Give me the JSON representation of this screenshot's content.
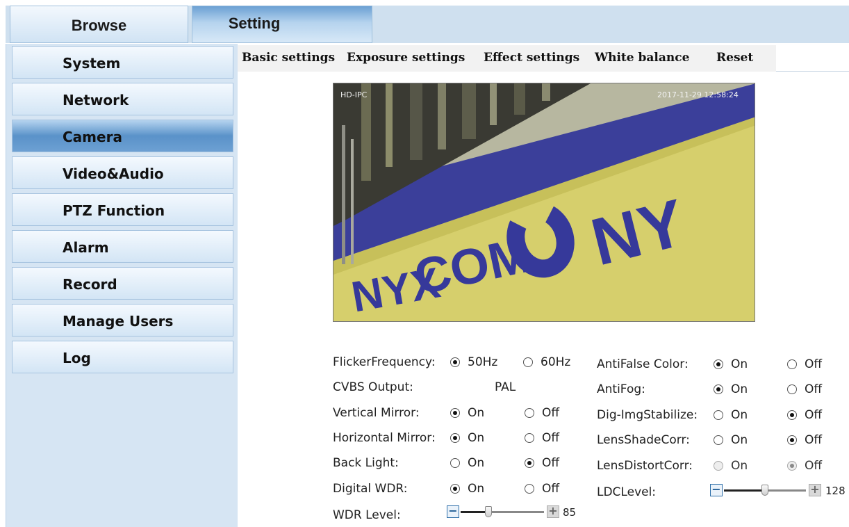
{
  "top_tabs": {
    "browse": "Browse",
    "setting": "Setting"
  },
  "sidebar": {
    "items": [
      {
        "label": "System"
      },
      {
        "label": "Network"
      },
      {
        "label": "Camera",
        "active": true
      },
      {
        "label": "Video&Audio"
      },
      {
        "label": "PTZ Function"
      },
      {
        "label": "Alarm"
      },
      {
        "label": "Record"
      },
      {
        "label": "Manage Users"
      },
      {
        "label": "Log"
      }
    ]
  },
  "sub_tabs": [
    "Basic settings",
    "Exposure settings",
    "Effect settings",
    "White balance",
    "Reset"
  ],
  "video": {
    "osd_name": "HD-IPC",
    "osd_time": "2017-11-29  12:58:24",
    "sign_left": "NYX",
    "sign_word": "COM",
    "sign_right": "NY"
  },
  "settings_left": {
    "flicker": {
      "label": "FlickerFrequency:",
      "opt1": "50Hz",
      "opt2": "60Hz",
      "selected": "50Hz"
    },
    "cvbs": {
      "label": "CVBS Output:",
      "value": "PAL"
    },
    "vmirror": {
      "label": "Vertical Mirror:",
      "opt1": "On",
      "opt2": "Off",
      "selected": "On"
    },
    "hmirror": {
      "label": "Horizontal Mirror:",
      "opt1": "On",
      "opt2": "Off",
      "selected": "On"
    },
    "backlight": {
      "label": "Back Light:",
      "opt1": "On",
      "opt2": "Off",
      "selected": "Off"
    },
    "dwdr": {
      "label": "Digital WDR:",
      "opt1": "On",
      "opt2": "Off",
      "selected": "On"
    },
    "wdr_level": {
      "label": "WDR Level:",
      "value": "85",
      "min": 0,
      "max": 255
    }
  },
  "settings_right": {
    "antifalse": {
      "label": "AntiFalse Color:",
      "opt1": "On",
      "opt2": "Off",
      "selected": "On"
    },
    "antifog": {
      "label": "AntiFog:",
      "opt1": "On",
      "opt2": "Off",
      "selected": "On"
    },
    "digimg": {
      "label": "Dig-ImgStabilize:",
      "opt1": "On",
      "opt2": "Off",
      "selected": "Off"
    },
    "lensshade": {
      "label": "LensShadeCorr:",
      "opt1": "On",
      "opt2": "Off",
      "selected": "Off"
    },
    "lensdistort": {
      "label": "LensDistortCorr:",
      "opt1": "On",
      "opt2": "Off",
      "selected": "Off",
      "disabled": true
    },
    "ldc_level": {
      "label": "LDCLevel:",
      "value": "128",
      "min": 0,
      "max": 255
    }
  }
}
